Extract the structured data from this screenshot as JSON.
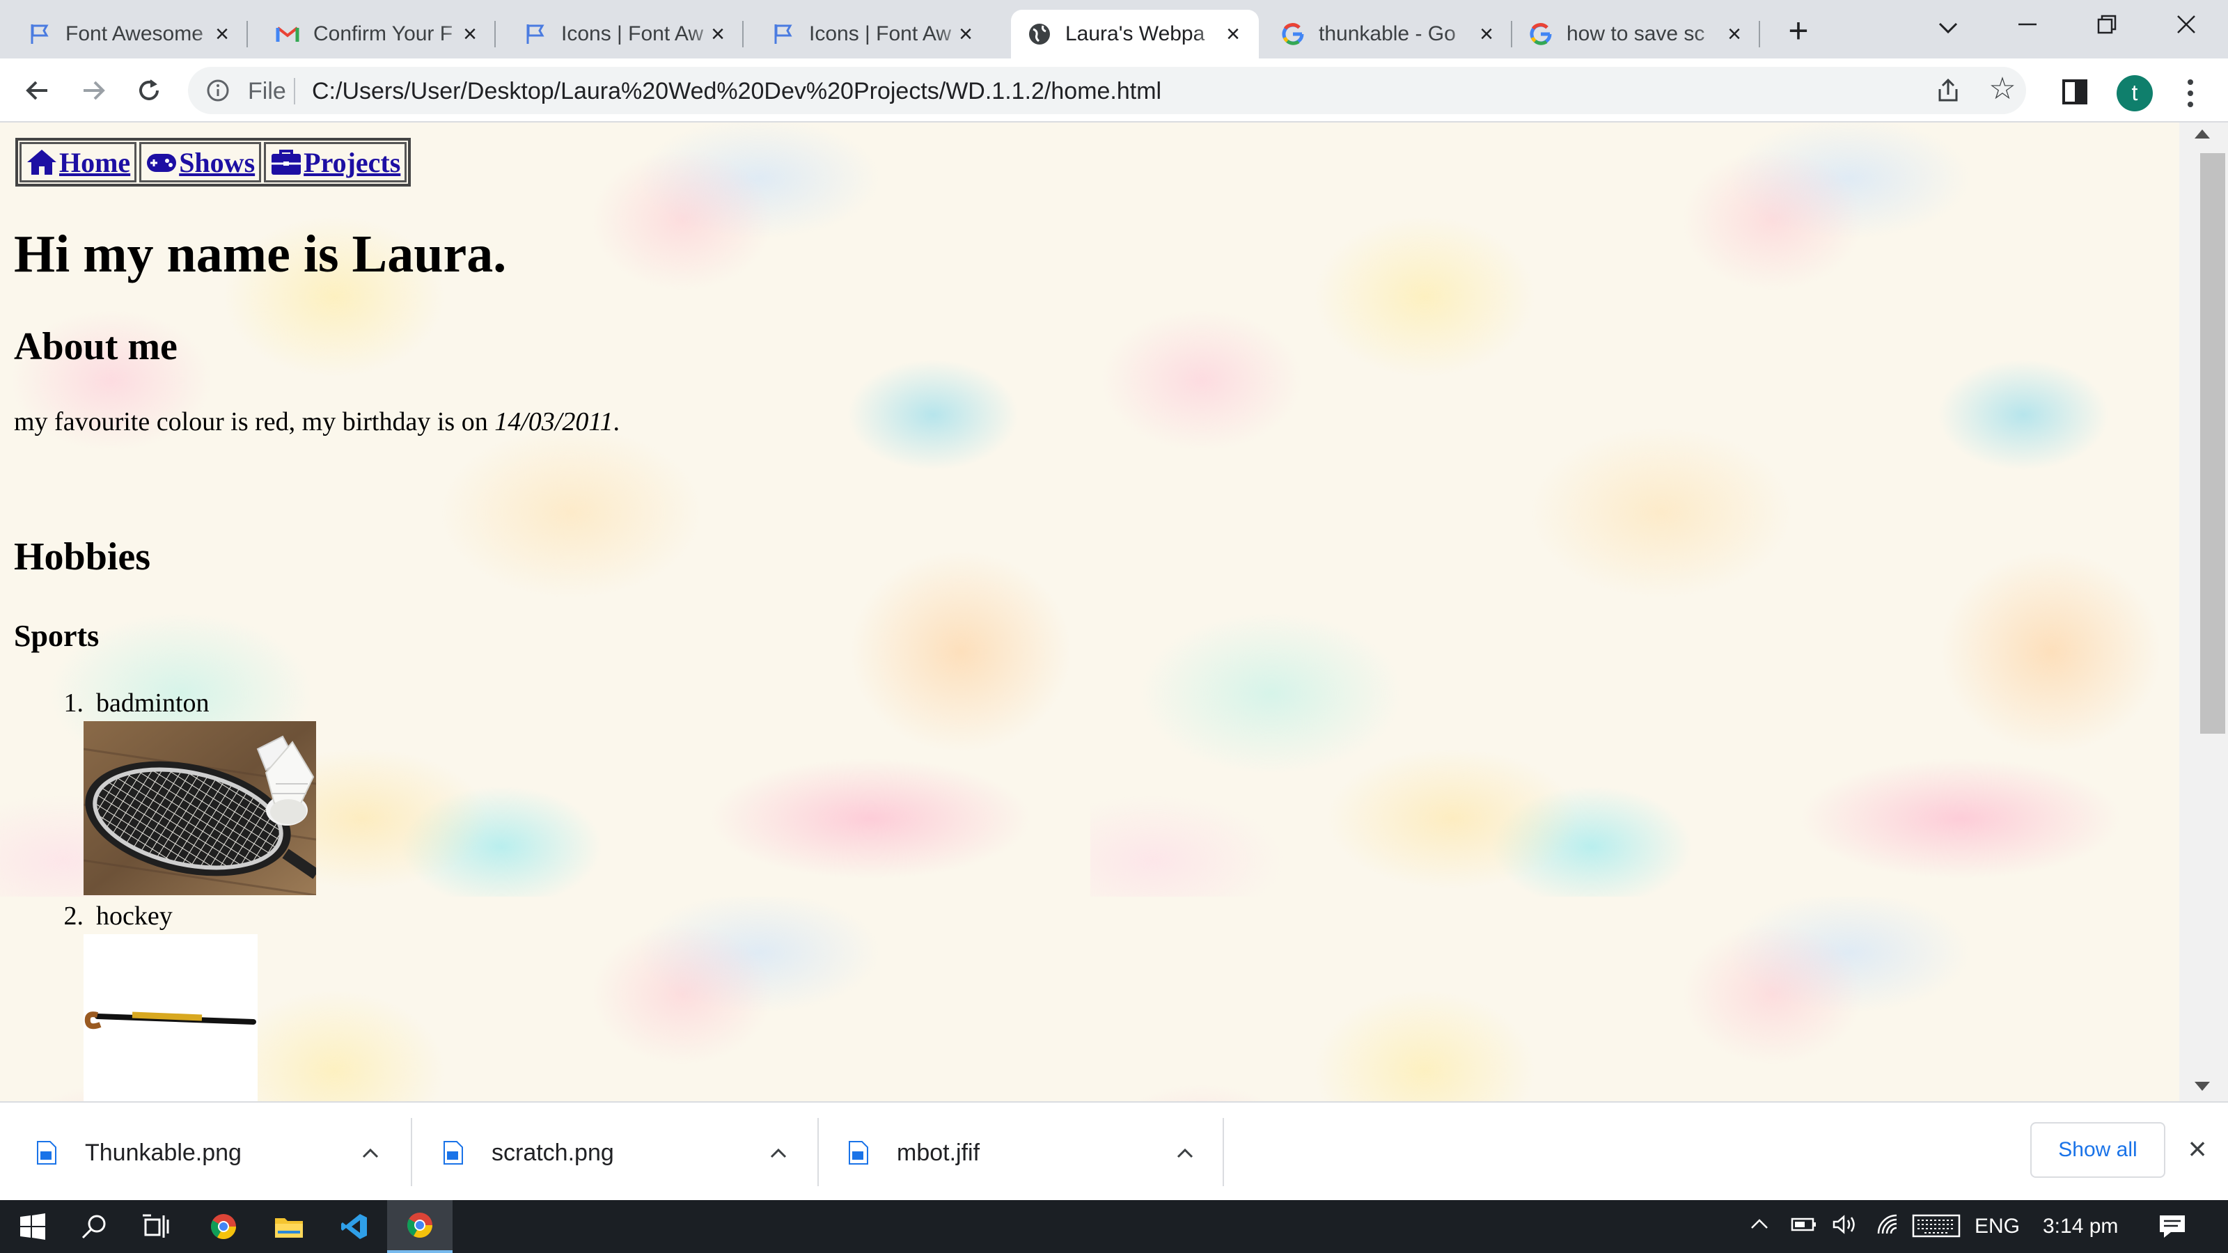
{
  "browser": {
    "tabs": [
      {
        "title": "Font Awesome",
        "icon": "flag-icon",
        "active": false
      },
      {
        "title": "Confirm Your F",
        "icon": "gmail-icon",
        "active": false
      },
      {
        "title": "Icons | Font Aw",
        "icon": "flag-icon",
        "active": false
      },
      {
        "title": "Icons | Font Aw",
        "icon": "flag-icon",
        "active": false
      },
      {
        "title": "Laura's Webpa",
        "icon": "globe-icon",
        "active": true
      },
      {
        "title": "thunkable - Go",
        "icon": "google-icon",
        "active": false
      },
      {
        "title": "how to save sc",
        "icon": "google-icon",
        "active": false
      }
    ],
    "address": {
      "scheme_label": "File",
      "url": "C:/Users/User/Desktop/Laura%20Wed%20Dev%20Projects/WD.1.1.2/home.html"
    },
    "profile_initial": "t"
  },
  "page": {
    "nav": [
      {
        "label": "Home",
        "icon": "house-icon"
      },
      {
        "label": "Shows",
        "icon": "gamepad-icon"
      },
      {
        "label": "Projects",
        "icon": "briefcase-icon"
      }
    ],
    "heading": "Hi my name is Laura.",
    "about_heading": "About me",
    "about_text": "my favourite colour is red, my birthday is on ",
    "birthday": "14/03/2011",
    "about_end": ".",
    "hobbies_heading": "Hobbies",
    "sports_heading": "Sports",
    "sports": [
      {
        "num": "1.",
        "label": "badminton",
        "image": "badminton-racket-shuttlecock"
      },
      {
        "num": "2.",
        "label": "hockey",
        "image": "hockey-stick"
      }
    ]
  },
  "downloads": {
    "items": [
      {
        "name": "Thunkable.png"
      },
      {
        "name": "scratch.png"
      },
      {
        "name": "mbot.jfif"
      }
    ],
    "show_all": "Show all"
  },
  "taskbar": {
    "language": "ENG",
    "time": "3:14 pm"
  },
  "colors": {
    "link": "#1d0fa3",
    "profile": "#0f7f6c",
    "show_all": "#1a73e8"
  }
}
